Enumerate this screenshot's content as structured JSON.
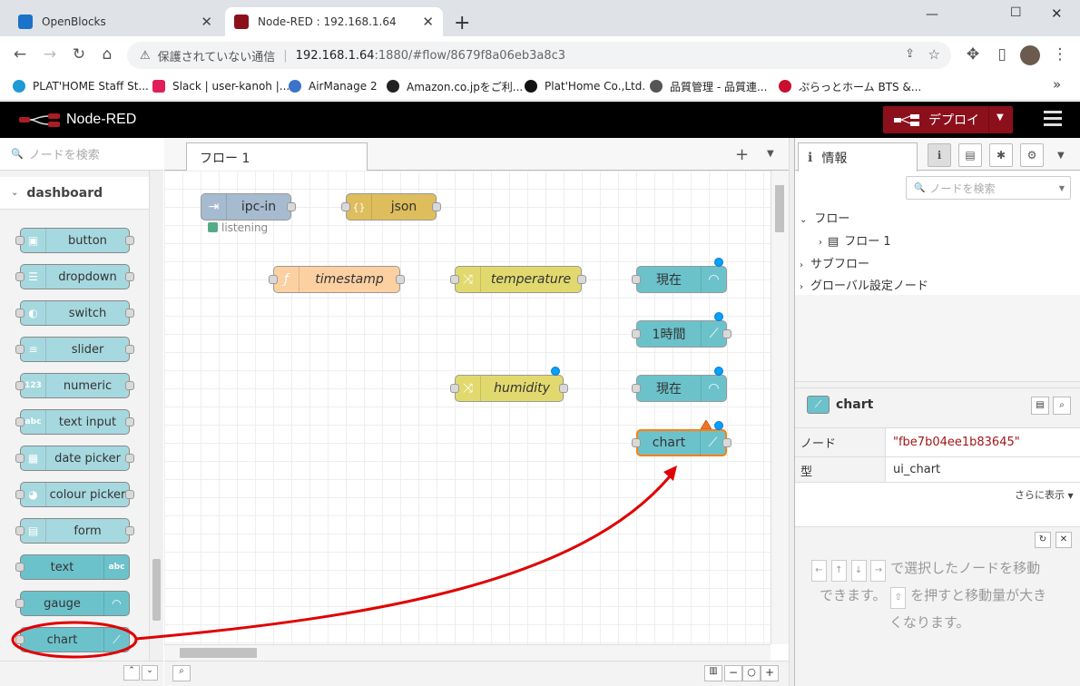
{
  "browser": {
    "tabs": [
      {
        "title": "OpenBlocks",
        "active": false
      },
      {
        "title": "Node-RED : 192.168.1.64",
        "active": true
      }
    ],
    "new_tab": "+",
    "window_controls": {
      "minimize": "—",
      "maximize": "☐",
      "close": "✕"
    },
    "url_warning": "保護されていない通信",
    "url_host": "192.168.1.64",
    "url_rest": ":1880/#flow/8679f8a06eb3a8c3",
    "bookmarks": [
      "PLAT'HOME Staff St...",
      "Slack | user-kanoh |...",
      "AirManage 2",
      "Amazon.co.jpをご利...",
      "Plat'Home Co.,Ltd.",
      "品質管理 - 品質連...",
      "ぷらっとホーム BTS &..."
    ],
    "bookmarks_more": "»"
  },
  "app": {
    "title": "Node-RED",
    "deploy_label": "デプロイ"
  },
  "palette": {
    "search_placeholder": "ノードを検索",
    "category": "dashboard",
    "nodes": [
      {
        "label": "button",
        "icon": "▣"
      },
      {
        "label": "dropdown",
        "icon": "☰"
      },
      {
        "label": "switch",
        "icon": "◐"
      },
      {
        "label": "slider",
        "icon": "≡"
      },
      {
        "label": "numeric",
        "icon": "123"
      },
      {
        "label": "text input",
        "icon": "abc"
      },
      {
        "label": "date picker",
        "icon": "▦"
      },
      {
        "label": "colour picker",
        "icon": "◕"
      },
      {
        "label": "form",
        "icon": "▤"
      },
      {
        "label": "text",
        "icon": "abc"
      },
      {
        "label": "gauge",
        "icon": "◠"
      },
      {
        "label": "chart",
        "icon": "⟋"
      }
    ]
  },
  "workspace": {
    "tab_label": "フロー 1",
    "add_tab": "+",
    "nodes": {
      "ipc_in": "ipc-in",
      "ipc_status": "listening",
      "json": "json",
      "timestamp": "timestamp",
      "temperature": "temperature",
      "gauge1": "現在",
      "chart1": "1時間",
      "humidity": "humidity",
      "gauge2": "現在",
      "chart2": "chart"
    }
  },
  "sidebar": {
    "tab_label": "情報",
    "search_placeholder": "ノードを検索",
    "tree": {
      "flows": "フロー",
      "flow1": "フロー 1",
      "subflows": "サブフロー",
      "global": "グローバル設定ノード"
    },
    "info": {
      "node_title": "chart",
      "rows": [
        {
          "key": "ノード",
          "value": "\"fbe7b04ee1b83645\""
        },
        {
          "key": "型",
          "value": "ui_chart"
        }
      ],
      "more": "さらに表示"
    },
    "help": {
      "line1": "で選択したノードを移動",
      "line2_pre": "できます。",
      "line2_post": "を押すと移動量が大き",
      "line3": "くなります。"
    }
  },
  "colors": {
    "dashboard_node": "#a6d8df",
    "dashboard_node_alt": "#6cc2cb",
    "function": "#fdd0a2",
    "change": "#e2d96e",
    "json": "#debd5c",
    "ipc": "#a6bbcf",
    "deploy": "#8c101c",
    "selection": "#ff7f0e",
    "annotation": "#e00000"
  }
}
